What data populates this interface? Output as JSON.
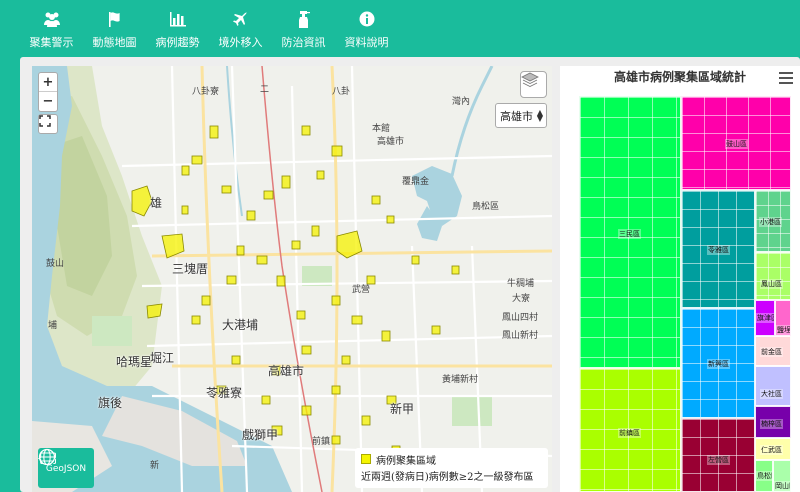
{
  "nav": {
    "items": [
      {
        "label": "聚集警示",
        "icon": "people-group-icon"
      },
      {
        "label": "動態地圖",
        "icon": "flag-icon"
      },
      {
        "label": "病例趨勢",
        "icon": "bar-chart-icon"
      },
      {
        "label": "境外移入",
        "icon": "airplane-icon"
      },
      {
        "label": "防治資訊",
        "icon": "spray-bottle-icon"
      },
      {
        "label": "資料說明",
        "icon": "info-circle-icon"
      }
    ]
  },
  "map": {
    "zoom_in": "+",
    "zoom_out": "−",
    "city_select": "高雄市",
    "geojson_label": "GeoJSON",
    "legend": {
      "item": "病例聚集區域",
      "note": "近兩週(發病日)病例數≥2之一級發布區"
    },
    "places": [
      "八卦寮",
      "八卦",
      "灣內",
      "本館",
      "高雄市",
      "覆鼎金",
      "鳥松區",
      "雄",
      "三塊厝",
      "鼓山",
      "大港埔",
      "牛稠埔",
      "大寮",
      "武營",
      "哈瑪星",
      "堀江",
      "鳳山四村",
      "旗後",
      "苓雅寮",
      "高雄市",
      "鳳山新村",
      "戲獅甲",
      "前鎮",
      "新甲",
      "黃埔新村",
      "新",
      "埔",
      "二"
    ]
  },
  "chart": {
    "title": "高雄市病例聚集區域統計",
    "menu_icon": "hamburger-menu-icon",
    "districts": [
      {
        "name": "三民區",
        "color": "#00ff55"
      },
      {
        "name": "前鎮區",
        "color": "#aaff00"
      },
      {
        "name": "苓雅區",
        "color": "#00a0a0"
      },
      {
        "name": "新興區",
        "color": "#00aaff"
      },
      {
        "name": "鼓山區",
        "color": "#ff00aa"
      },
      {
        "name": "左營區",
        "color": "#990033"
      },
      {
        "name": "小港區",
        "color": "#5fd38d"
      },
      {
        "name": "鳳山區",
        "color": "#aaff66"
      },
      {
        "name": "旗津區",
        "color": "#cc00ff"
      },
      {
        "name": "鹽埕區",
        "color": "#ff66cc"
      },
      {
        "name": "前金區",
        "color": "#ffd9d9"
      },
      {
        "name": "大社區",
        "color": "#c0c0ff"
      },
      {
        "name": "楠梓區",
        "color": "#7700aa"
      },
      {
        "name": "仁武區",
        "color": "#ffffaa"
      },
      {
        "name": "鳥松區",
        "color": "#88ff88"
      },
      {
        "name": "岡山區",
        "color": "#aaffaa"
      }
    ],
    "legend_extra": [
      "高雄市"
    ]
  }
}
